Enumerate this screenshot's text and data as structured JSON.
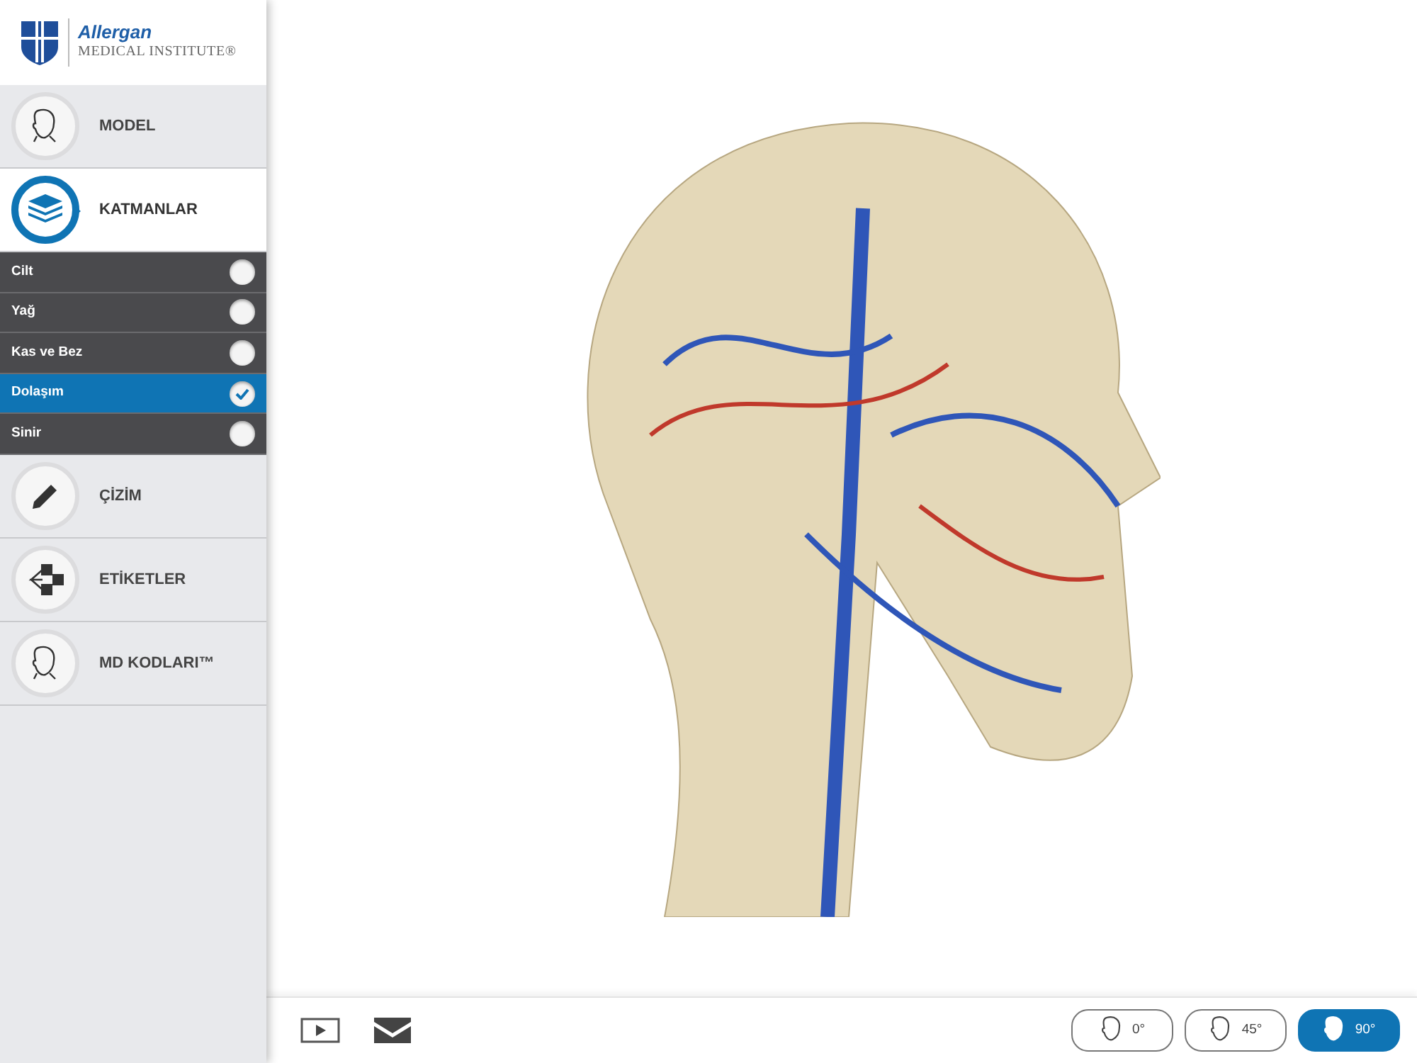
{
  "logo": {
    "brand": "Allergan",
    "subtitle": "MEDICAL INSTITUTE®"
  },
  "menu": [
    {
      "kind": "model",
      "label": "MODEL",
      "selected": false
    },
    {
      "kind": "layers",
      "label": "KATMANLAR",
      "selected": true,
      "layers": [
        {
          "label": "Cilt",
          "checked": false
        },
        {
          "label": "Yağ",
          "checked": false
        },
        {
          "label": "Kas ve Bez",
          "checked": false
        },
        {
          "label": "Dolaşım",
          "checked": true
        },
        {
          "label": "Sinir",
          "checked": false
        }
      ]
    },
    {
      "kind": "draw",
      "label": "ÇİZİM",
      "selected": false
    },
    {
      "kind": "labels",
      "label": "ETİKETLER",
      "selected": false
    },
    {
      "kind": "codes",
      "label": "MD KODLARI™",
      "selected": false
    }
  ],
  "views": [
    {
      "label": "0°",
      "selected": false
    },
    {
      "label": "45°",
      "selected": false
    },
    {
      "label": "90°",
      "selected": true
    }
  ]
}
